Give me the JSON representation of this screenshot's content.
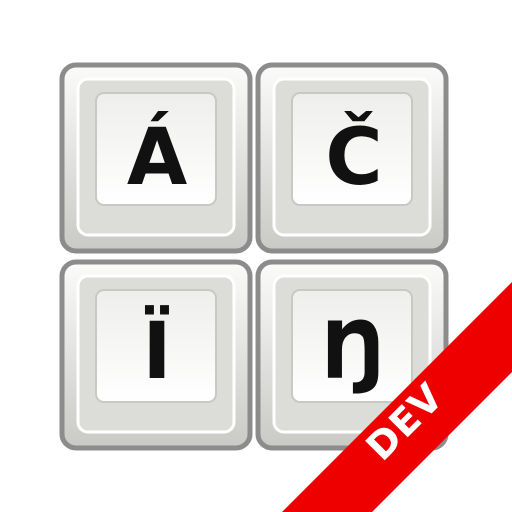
{
  "keys": [
    {
      "label": "Á"
    },
    {
      "label": "Č"
    },
    {
      "label": "Ï"
    },
    {
      "label": "Ŋ"
    }
  ],
  "badge": {
    "label": "DEV",
    "color": "#ee0000"
  },
  "colors": {
    "key_border": "#8c8c8c",
    "key_face": "#f4f4f2",
    "key_side": "#cdcdca",
    "text": "#111111"
  }
}
